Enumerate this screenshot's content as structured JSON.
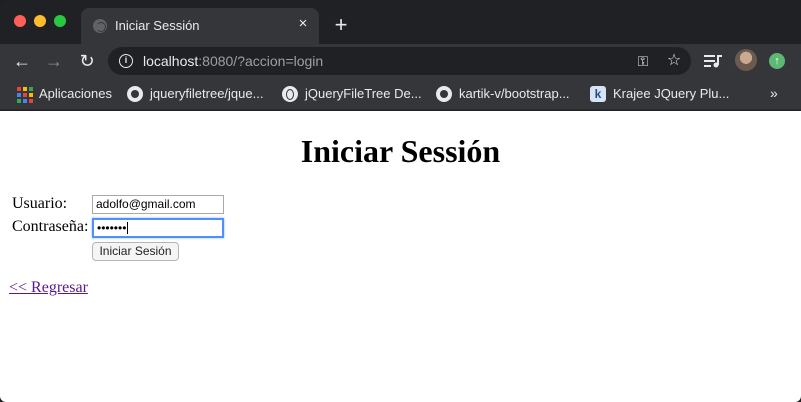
{
  "browser": {
    "tab": {
      "title": "Iniciar Sessión",
      "close_glyph": "×",
      "favicon": "globe-icon"
    },
    "new_tab_glyph": "+",
    "nav": {
      "back_glyph": "←",
      "forward_glyph": "→",
      "reload_glyph": "↻"
    },
    "address": {
      "host": "localhost",
      "rest": ":8080/?accion=login",
      "info_glyph": "i"
    },
    "address_icons": {
      "key_glyph": "⚿",
      "star_glyph": "☆"
    },
    "update_glyph": "↑",
    "bookmarks": [
      {
        "label": "Aplicaciones",
        "icon": "apps-grid-icon"
      },
      {
        "label": "jqueryfiletree/jque...",
        "icon": "github-icon"
      },
      {
        "label": "jQueryFileTree De...",
        "icon": "globe-icon"
      },
      {
        "label": "kartik-v/bootstrap...",
        "icon": "github-icon"
      },
      {
        "label": "Krajee JQuery Plu...",
        "icon": "krajee-icon",
        "icon_letter": "k"
      }
    ],
    "bookmarks_overflow_glyph": "»",
    "apps_colors": [
      "#ea4335",
      "#fbbc04",
      "#34a853",
      "#4285f4",
      "#ea4335",
      "#fbbc04",
      "#34a853",
      "#4285f4",
      "#ea4335"
    ]
  },
  "page": {
    "title": "Iniciar Sessión",
    "form": {
      "user_label": "Usuario:",
      "user_value": "adolfo@gmail.com",
      "password_label": "Contraseña:",
      "password_value": "•••••••",
      "submit_label": "Iniciar Sesión"
    },
    "back_link": "<< Regresar"
  },
  "colors": {
    "link_visited": "#551a8b",
    "focus_ring": "#4d90fe"
  }
}
